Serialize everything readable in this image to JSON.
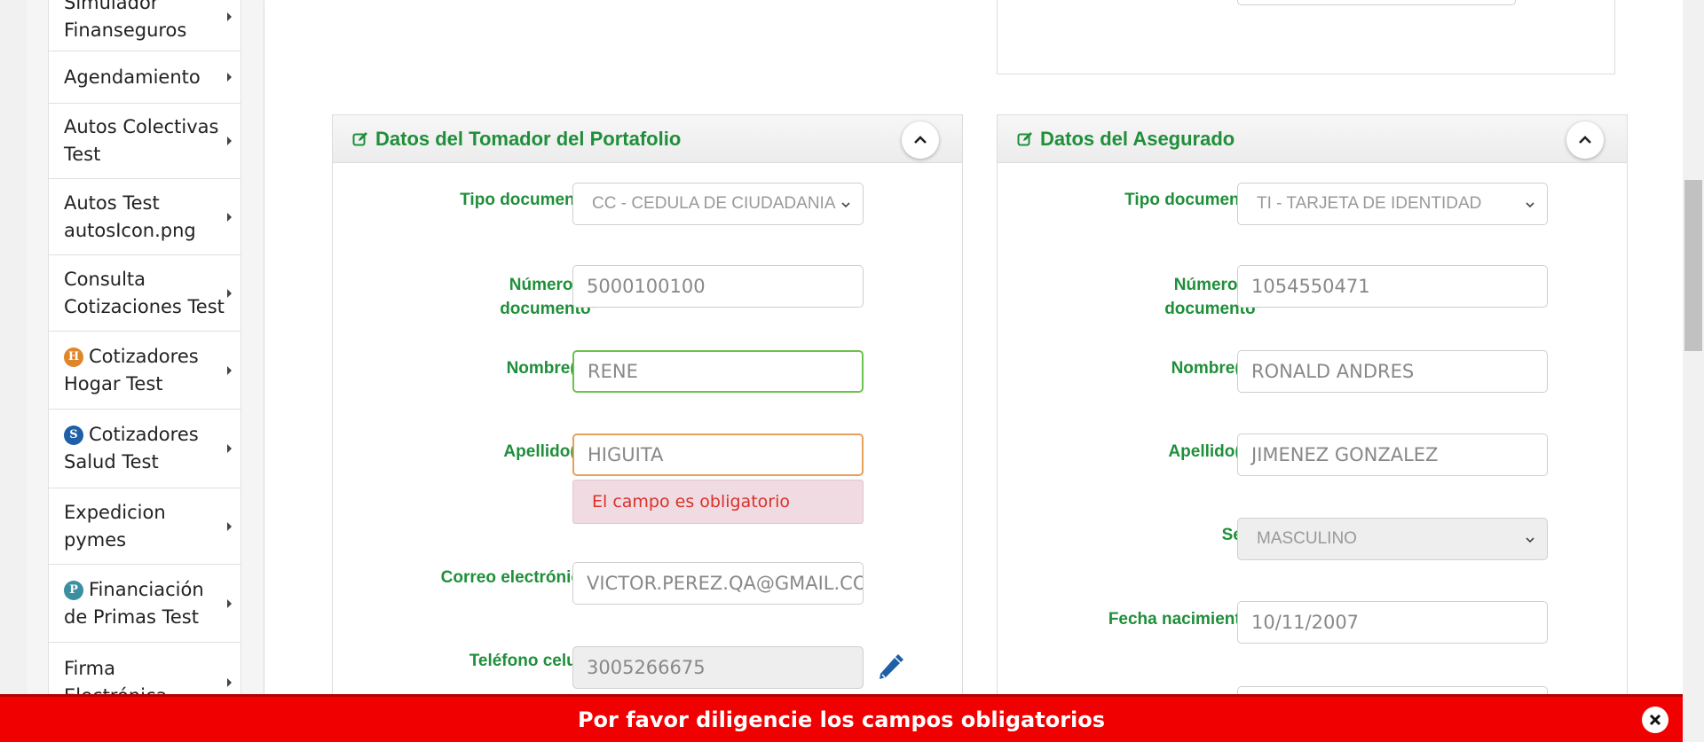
{
  "sidebar": {
    "items": [
      {
        "lines": [
          "Simulador",
          "Finanseguros"
        ]
      },
      {
        "lines": [
          "Agendamiento"
        ]
      },
      {
        "lines": [
          "Autos Colectivas",
          "Test"
        ]
      },
      {
        "lines": [
          "Autos Test",
          "autosIcon.png"
        ]
      },
      {
        "lines": [
          "Consulta",
          "Cotizaciones Test"
        ]
      },
      {
        "badge": "H",
        "badge_color": "#e0862a",
        "lines": [
          "Cotizadores",
          "Hogar Test"
        ]
      },
      {
        "badge": "S",
        "badge_color": "#1f5fa8",
        "lines": [
          "Cotizadores",
          "Salud Test"
        ]
      },
      {
        "lines": [
          "Expedicion",
          "pymes"
        ]
      },
      {
        "badge": "P",
        "badge_color": "#3a8fa0",
        "lines": [
          "Financiación",
          "de Primas Test"
        ]
      },
      {
        "lines": [
          "Firma",
          "Electrónica"
        ]
      }
    ]
  },
  "tomador": {
    "title": "Datos del Tomador del Portafolio",
    "tipo_label": "Tipo documento",
    "tipo_value": "CC - CEDULA DE CIUDADANIA",
    "numero_label_1": "Número de",
    "numero_label_2": "documento",
    "numero_value": "5000100100",
    "nombre_label": "Nombre(s)",
    "nombre_value": "RENE",
    "apellido_label": "Apellido(s)",
    "apellido_value": "HIGUITA",
    "apellido_error": "El campo es obligatorio",
    "correo_label": "Correo electrónico",
    "correo_value": "VICTOR.PEREZ.QA@GMAIL.COM",
    "telefono_label": "Teléfono celular",
    "telefono_value": "3005266675"
  },
  "asegurado": {
    "title": "Datos del Asegurado",
    "tipo_label": "Tipo documento",
    "tipo_value": "TI - TARJETA DE IDENTIDAD",
    "numero_label_1": "Número de",
    "numero_label_2": "documento",
    "numero_value": "1054550471",
    "nombre_label": "Nombre(s)",
    "nombre_value": "RONALD ANDRES",
    "apellido_label": "Apellido(s)",
    "apellido_value": "JIMENEZ GONZALEZ",
    "sexo_label": "Sexo",
    "sexo_value": "MASCULINO",
    "fecha_label": "Fecha nacimiento",
    "fecha_value": "10/11/2007"
  },
  "required_mark": "*",
  "toast": {
    "message": "Por favor diligencie los campos obligatorios"
  },
  "colors": {
    "accent_green": "#1f8f3a",
    "error_red": "#d9312a",
    "toast_red": "#f00000"
  }
}
